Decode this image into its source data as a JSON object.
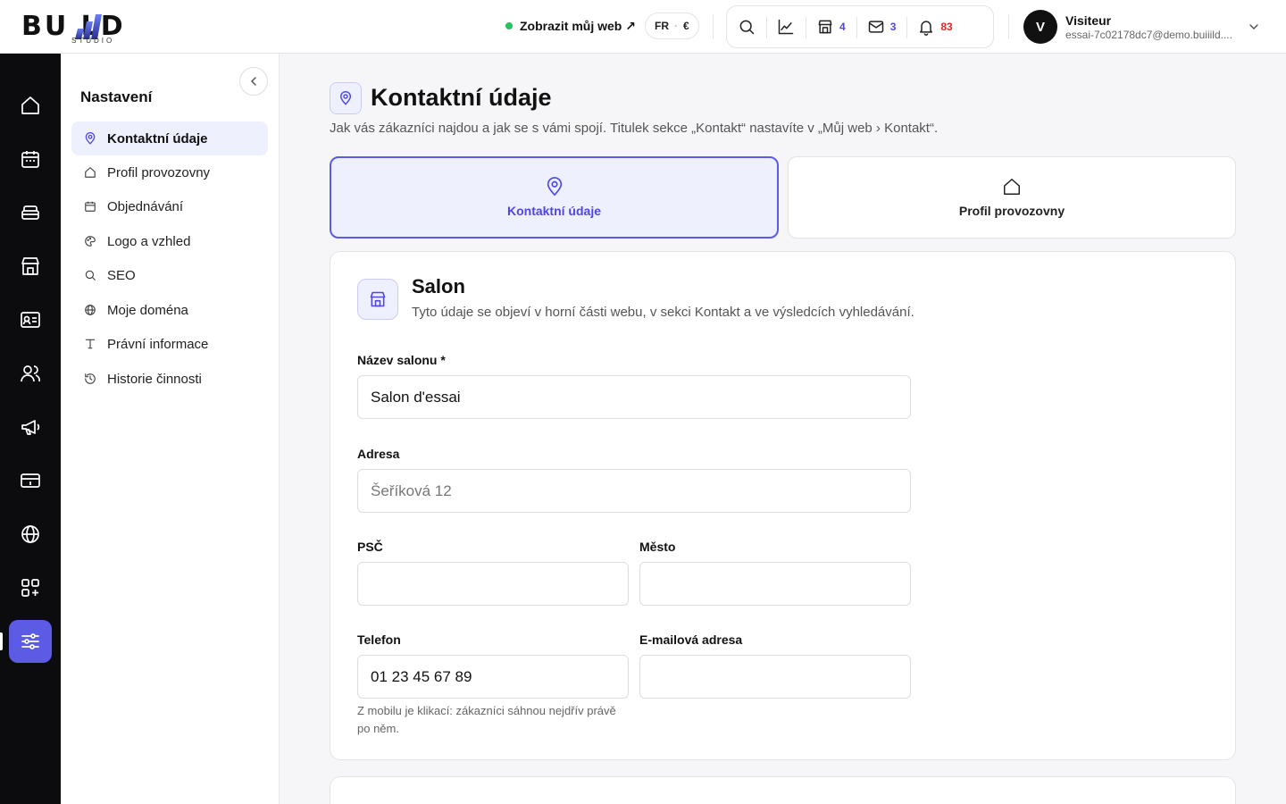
{
  "topbar": {
    "logo_text": "BU   LD",
    "logo_sub": "STUDIO",
    "view_web_label": "Zobrazit můj web ↗",
    "lang": "FR",
    "currency": "€",
    "shop_count": "4",
    "mail_count": "3",
    "notif_count": "83",
    "icons": [
      "search-icon",
      "chart-icon",
      "store-icon",
      "mail-icon",
      "bell-icon"
    ]
  },
  "user": {
    "initial": "V",
    "name": "Visiteur",
    "email": "essai-7c02178dc7@demo.buiiild...."
  },
  "rail": {
    "items": [
      "home-icon",
      "calendar-icon",
      "services-icon",
      "store-icon",
      "contact-card-icon",
      "users-icon",
      "megaphone-icon",
      "payment-icon",
      "globe-icon",
      "apps-icon",
      "settings-sliders-icon"
    ],
    "active": "settings-sliders-icon"
  },
  "settings": {
    "title": "Nastavení",
    "items": [
      {
        "label": "Kontaktní údaje",
        "icon": "location-pin-icon"
      },
      {
        "label": "Profil provozovny",
        "icon": "home-icon"
      },
      {
        "label": "Objednávání",
        "icon": "calendar-icon"
      },
      {
        "label": "Logo a vzhled",
        "icon": "palette-icon"
      },
      {
        "label": "SEO",
        "icon": "search-icon"
      },
      {
        "label": "Moje doména",
        "icon": "globe-icon"
      },
      {
        "label": "Právní informace",
        "icon": "text-icon"
      },
      {
        "label": "Historie činnosti",
        "icon": "history-icon"
      }
    ]
  },
  "page": {
    "title": "Kontaktní údaje",
    "description": "Jak vás zákazníci najdou a jak se s vámi spojí. Titulek sekce „Kontakt“ nastavíte v „Můj web › Kontakt“.",
    "tabs": [
      {
        "label": "Kontaktní údaje",
        "icon": "location-pin-icon",
        "active": true
      },
      {
        "label": "Profil provozovny",
        "icon": "home-icon",
        "active": false
      }
    ]
  },
  "section": {
    "title": "Salon",
    "description": "Tyto údaje se objeví v horní části webu, v sekci Kontakt a ve výsledcích vyhledávání.",
    "fields": {
      "name_label": "Název salonu *",
      "name_value": "Salon d'essai",
      "address_label": "Adresa",
      "address_placeholder": "Šeříková 12",
      "zip_label": "PSČ",
      "zip_value": "",
      "city_label": "Město",
      "city_value": "",
      "phone_label": "Telefon",
      "phone_value": "01 23 45 67 89",
      "email_label": "E-mailová adresa",
      "email_value": "",
      "phone_hint": "Z mobilu je klikací: zákazníci sáhnou nejdřív právě po něm."
    }
  },
  "colors": {
    "accent": "#5b5be6",
    "accent_light": "#eef0fd",
    "rail_bg": "#0c0c0f",
    "online": "#22c55e",
    "badge_blue": "#4f46e5",
    "badge_red": "#dc2626"
  }
}
